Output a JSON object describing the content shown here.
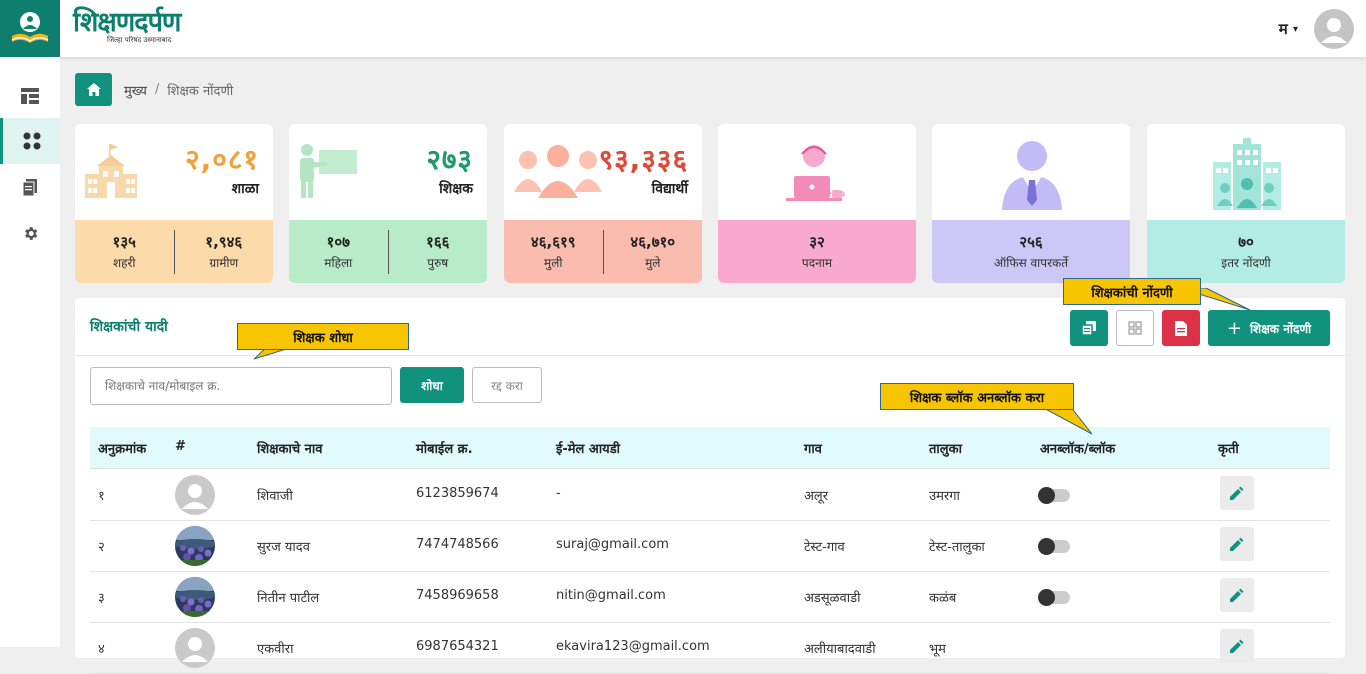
{
  "brand": {
    "title": "शिक्षणदर्पण",
    "subtitle": "जिल्हा परिषद उस्मानाबाद"
  },
  "user": {
    "initial": "म",
    "menu_caret": "▾"
  },
  "sidebar": {
    "items": [
      {
        "name": "dashboard-icon",
        "active": false
      },
      {
        "name": "grid-icon",
        "active": true
      },
      {
        "name": "documents-icon",
        "active": false
      },
      {
        "name": "gear-icon",
        "active": false
      }
    ]
  },
  "breadcrumb": {
    "home": "मुख्य",
    "separator": "/",
    "current": "शिक्षक नोंदणी"
  },
  "stats": [
    {
      "value": "२,०८१",
      "label": "शाळा",
      "color": "#f0a139",
      "bottom_bg": "#fcdaa9",
      "icon": "school-icon",
      "sub": [
        {
          "value": "१३५",
          "label": "शहरी"
        },
        {
          "value": "१,९४६",
          "label": "ग्रामीण"
        }
      ]
    },
    {
      "value": "२७३",
      "label": "शिक्षक",
      "color": "#1f9a6a",
      "bottom_bg": "#b8ebc8",
      "icon": "teacher-icon",
      "sub": [
        {
          "value": "१०७",
          "label": "महिला"
        },
        {
          "value": "१६६",
          "label": "पुरुष"
        }
      ]
    },
    {
      "value": "९३,३३६",
      "label": "विद्यार्थी",
      "color": "#e0493a",
      "bottom_bg": "#f9bcae",
      "icon": "students-icon",
      "sub": [
        {
          "value": "४६,६१९",
          "label": "मुली"
        },
        {
          "value": "४६,७१०",
          "label": "मुले"
        }
      ]
    },
    {
      "value": "",
      "label": "",
      "color": "#e8508b",
      "bottom_bg": "#f9a9cd",
      "icon": "office-worker-icon",
      "sub": [
        {
          "value": "३२",
          "label": "पदनाम"
        }
      ]
    },
    {
      "value": "",
      "label": "",
      "color": "#7b72d6",
      "bottom_bg": "#cdc7f8",
      "icon": "officer-icon",
      "sub": [
        {
          "value": "२५६",
          "label": "ऑफिस वापरकर्ते"
        }
      ]
    },
    {
      "value": "",
      "label": "",
      "color": "#2cb4a6",
      "bottom_bg": "#b3ece4",
      "icon": "buildings-icon",
      "sub": [
        {
          "value": "७०",
          "label": "इतर नोंदणी"
        }
      ]
    }
  ],
  "panel": {
    "title": "शिक्षकांची यादी",
    "toolbar": {
      "copy_icon": "copy-icon",
      "grid_icon": "grid-view-icon",
      "pdf_icon": "pdf-icon",
      "add_plus": "+",
      "add_label": "शिक्षक नोंदणी"
    },
    "search": {
      "placeholder": "शिक्षकाचे नाव/मोबाइल क्र.",
      "search_label": "शोधा",
      "cancel_label": "रद्द करा"
    },
    "columns": [
      "अनुक्रमांक",
      "#",
      "शिक्षकाचे नाव",
      "मोबाईल क्र.",
      "ई-मेल आयडी",
      "गाव",
      "तालुका",
      "अनब्लॉक/ब्लॉक",
      "कृती"
    ],
    "rows": [
      {
        "sr": "१",
        "name": "शिवाजी",
        "mobile": "6123859674",
        "email": "-",
        "village": "अलूर",
        "taluka": "उमरगा",
        "avatar": "placeholder"
      },
      {
        "sr": "२",
        "name": "सुरज यादव",
        "mobile": "7474748566",
        "email": "suraj@gmail.com",
        "village": "टेस्ट-गाव",
        "taluka": "टेस्ट-तालुका",
        "avatar": "photo"
      },
      {
        "sr": "३",
        "name": "नितीन पाटील",
        "mobile": "7458969658",
        "email": "nitin@gmail.com",
        "village": "अडसूळवाडी",
        "taluka": "कळंब",
        "avatar": "photo"
      },
      {
        "sr": "४",
        "name": "एकवीरा",
        "mobile": "6987654321",
        "email": "ekavira123@gmail.com",
        "village": "अलीयाबादवाडी",
        "taluka": "भूम",
        "avatar": "placeholder"
      }
    ]
  },
  "callouts": {
    "add": "शिक्षकांची नोंदणी",
    "search": "शिक्षक शोधा",
    "block": "शिक्षक ब्लॉक अनब्लॉक करा"
  }
}
